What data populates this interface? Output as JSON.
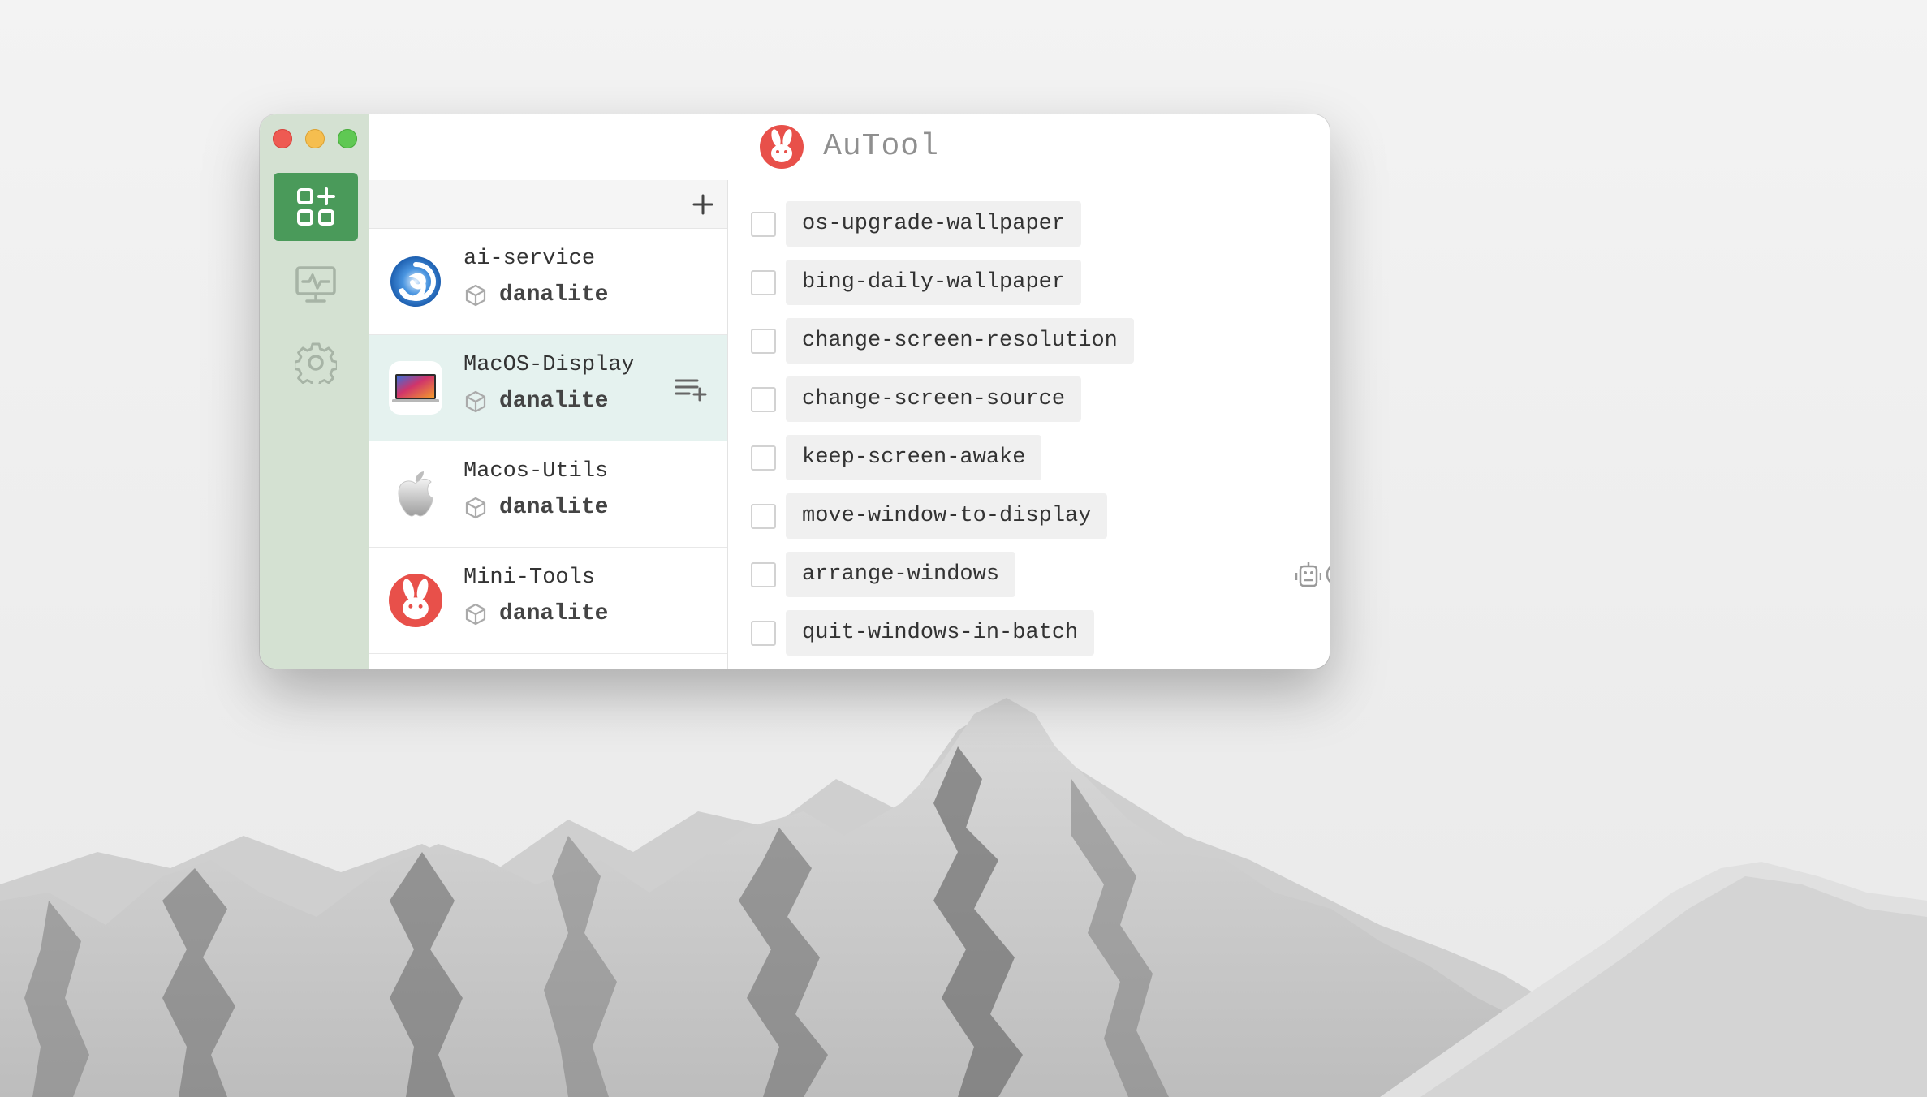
{
  "app": {
    "title": "AuTool",
    "accent_color": "#4a9a5a",
    "logo_color": "#e8504a"
  },
  "window_controls": [
    "close",
    "minimize",
    "zoom"
  ],
  "sidebar": {
    "items": [
      {
        "name": "apps",
        "icon": "apps-add-icon",
        "active": true
      },
      {
        "name": "monitor",
        "icon": "monitor-pulse-icon",
        "active": false
      },
      {
        "name": "settings",
        "icon": "gear-icon",
        "active": false
      }
    ]
  },
  "projects": {
    "add_icon": "plus-icon",
    "items": [
      {
        "name": "ai-service",
        "owner": "danalite",
        "icon": "swirl-logo-icon",
        "selected": false
      },
      {
        "name": "MacOS-Display",
        "owner": "danalite",
        "icon": "macbook-icon",
        "selected": true
      },
      {
        "name": "Macos-Utils",
        "owner": "danalite",
        "icon": "apple-logo-icon",
        "selected": false
      },
      {
        "name": "Mini-Tools",
        "owner": "danalite",
        "icon": "rabbit-logo-icon",
        "selected": false
      }
    ]
  },
  "scripts": {
    "items": [
      {
        "name": "os-upgrade-wallpaper",
        "checked": false,
        "tags": []
      },
      {
        "name": "bing-daily-wallpaper",
        "checked": false,
        "tags": []
      },
      {
        "name": "change-screen-resolution",
        "checked": false,
        "tags": []
      },
      {
        "name": "change-screen-source",
        "checked": false,
        "tags": [
          "clock-icon"
        ]
      },
      {
        "name": "keep-screen-awake",
        "checked": false,
        "tags": []
      },
      {
        "name": "move-window-to-display",
        "checked": false,
        "tags": []
      },
      {
        "name": "arrange-windows",
        "checked": false,
        "tags": [
          "robot-icon",
          "clock-icon",
          "keyboard-icon",
          "cloud-icon"
        ]
      },
      {
        "name": "quit-windows-in-batch",
        "checked": false,
        "tags": []
      }
    ]
  }
}
